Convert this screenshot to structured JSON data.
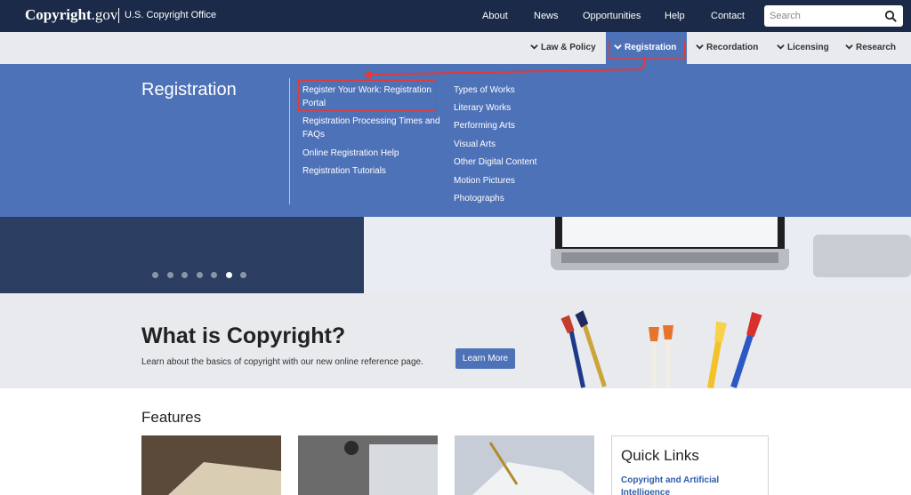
{
  "header": {
    "logo_main": "Copyright",
    "logo_suffix": ".gov",
    "office": "U.S. Copyright Office",
    "nav": [
      "About",
      "News",
      "Opportunities",
      "Help",
      "Contact"
    ],
    "search_placeholder": "Search"
  },
  "subnav": {
    "items": [
      "Law & Policy",
      "Registration",
      "Recordation",
      "Licensing",
      "Research"
    ],
    "active": "Registration"
  },
  "mega_menu": {
    "title": "Registration",
    "col1": [
      "Register Your Work: Registration Portal",
      "Registration Processing Times and FAQs",
      "Online Registration Help",
      "Registration Tutorials"
    ],
    "col2": [
      "Types of Works",
      "Literary Works",
      "Performing Arts",
      "Visual Arts",
      "Other Digital Content",
      "Motion Pictures",
      "Photographs"
    ]
  },
  "carousel": {
    "total": 7,
    "active_index": 5
  },
  "about": {
    "title": "What is Copyright?",
    "subtitle": "Learn about the basics of copyright with our new online reference page.",
    "button": "Learn More"
  },
  "features": {
    "title": "Features",
    "quick_links_title": "Quick Links",
    "quick_link_1": "Copyright and Artificial Intelligence"
  },
  "colors": {
    "topbar": "#1b2a48",
    "accent": "#4e72b8",
    "highlight": "#e53935"
  }
}
